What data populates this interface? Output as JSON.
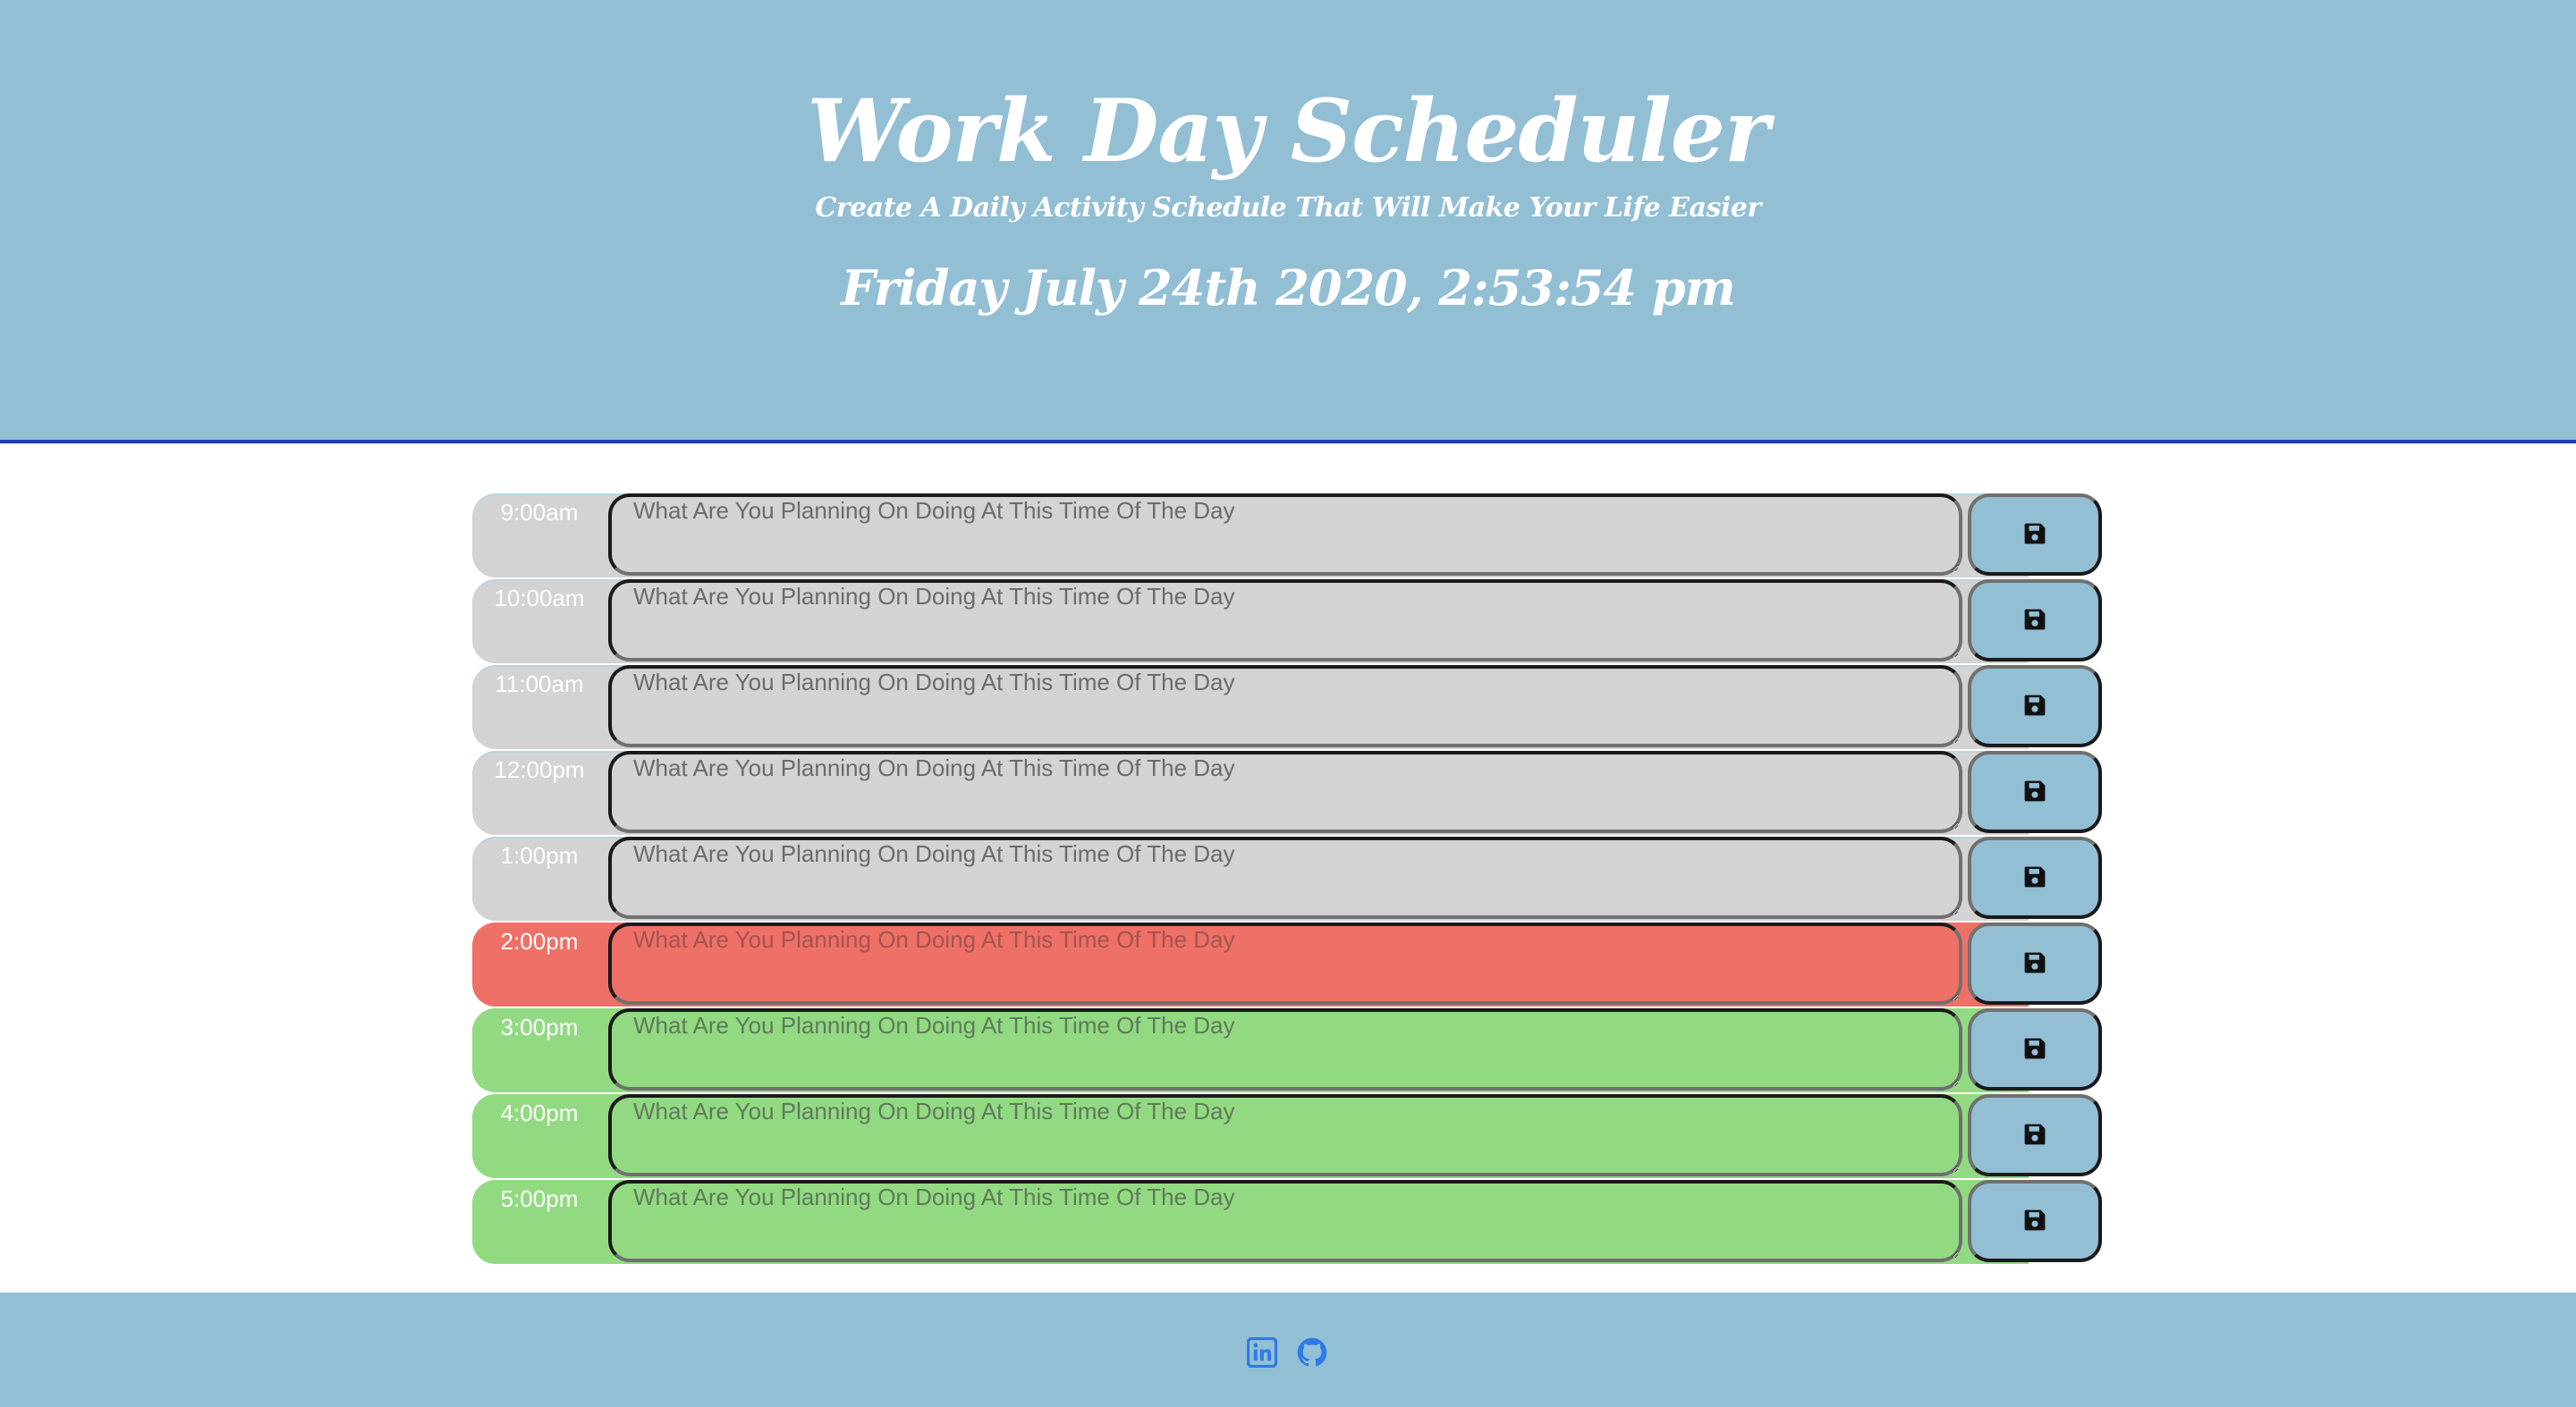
{
  "header": {
    "title": "Work Day Scheduler",
    "lead": "Create A Daily Activity Schedule That Will Make Your Life Easier",
    "current_day": "Friday July 24th 2020, 2:53:54 pm"
  },
  "schedule": {
    "placeholder": "What Are You Planning On Doing At This Time Of The Day",
    "save_icon": "floppy-disk-icon",
    "colors": {
      "past": "#d3d3d3",
      "present": "#ee7067",
      "future": "#92da82",
      "save": "#93bfd5"
    },
    "rows": [
      {
        "hour": "9:00am",
        "state": "past"
      },
      {
        "hour": "10:00am",
        "state": "past"
      },
      {
        "hour": "11:00am",
        "state": "past"
      },
      {
        "hour": "12:00pm",
        "state": "past"
      },
      {
        "hour": "1:00pm",
        "state": "past"
      },
      {
        "hour": "2:00pm",
        "state": "present"
      },
      {
        "hour": "3:00pm",
        "state": "future"
      },
      {
        "hour": "4:00pm",
        "state": "future"
      },
      {
        "hour": "5:00pm",
        "state": "future"
      }
    ]
  },
  "footer": {
    "icons": [
      "linkedin-icon",
      "github-icon"
    ],
    "icon_color": "#2f7ae5"
  }
}
